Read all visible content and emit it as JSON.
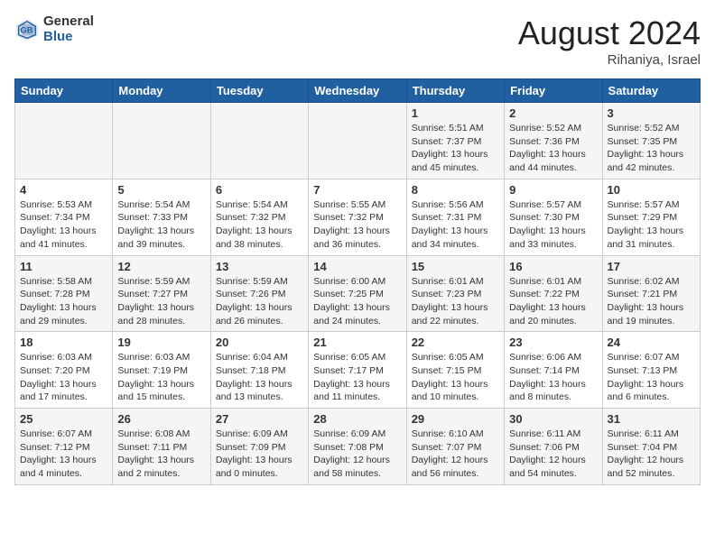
{
  "header": {
    "logo_general": "General",
    "logo_blue": "Blue",
    "month_year": "August 2024",
    "location": "Rihaniya, Israel"
  },
  "weekdays": [
    "Sunday",
    "Monday",
    "Tuesday",
    "Wednesday",
    "Thursday",
    "Friday",
    "Saturday"
  ],
  "weeks": [
    [
      {
        "day": "",
        "info": ""
      },
      {
        "day": "",
        "info": ""
      },
      {
        "day": "",
        "info": ""
      },
      {
        "day": "",
        "info": ""
      },
      {
        "day": "1",
        "info": "Sunrise: 5:51 AM\nSunset: 7:37 PM\nDaylight: 13 hours\nand 45 minutes."
      },
      {
        "day": "2",
        "info": "Sunrise: 5:52 AM\nSunset: 7:36 PM\nDaylight: 13 hours\nand 44 minutes."
      },
      {
        "day": "3",
        "info": "Sunrise: 5:52 AM\nSunset: 7:35 PM\nDaylight: 13 hours\nand 42 minutes."
      }
    ],
    [
      {
        "day": "4",
        "info": "Sunrise: 5:53 AM\nSunset: 7:34 PM\nDaylight: 13 hours\nand 41 minutes."
      },
      {
        "day": "5",
        "info": "Sunrise: 5:54 AM\nSunset: 7:33 PM\nDaylight: 13 hours\nand 39 minutes."
      },
      {
        "day": "6",
        "info": "Sunrise: 5:54 AM\nSunset: 7:32 PM\nDaylight: 13 hours\nand 38 minutes."
      },
      {
        "day": "7",
        "info": "Sunrise: 5:55 AM\nSunset: 7:32 PM\nDaylight: 13 hours\nand 36 minutes."
      },
      {
        "day": "8",
        "info": "Sunrise: 5:56 AM\nSunset: 7:31 PM\nDaylight: 13 hours\nand 34 minutes."
      },
      {
        "day": "9",
        "info": "Sunrise: 5:57 AM\nSunset: 7:30 PM\nDaylight: 13 hours\nand 33 minutes."
      },
      {
        "day": "10",
        "info": "Sunrise: 5:57 AM\nSunset: 7:29 PM\nDaylight: 13 hours\nand 31 minutes."
      }
    ],
    [
      {
        "day": "11",
        "info": "Sunrise: 5:58 AM\nSunset: 7:28 PM\nDaylight: 13 hours\nand 29 minutes."
      },
      {
        "day": "12",
        "info": "Sunrise: 5:59 AM\nSunset: 7:27 PM\nDaylight: 13 hours\nand 28 minutes."
      },
      {
        "day": "13",
        "info": "Sunrise: 5:59 AM\nSunset: 7:26 PM\nDaylight: 13 hours\nand 26 minutes."
      },
      {
        "day": "14",
        "info": "Sunrise: 6:00 AM\nSunset: 7:25 PM\nDaylight: 13 hours\nand 24 minutes."
      },
      {
        "day": "15",
        "info": "Sunrise: 6:01 AM\nSunset: 7:23 PM\nDaylight: 13 hours\nand 22 minutes."
      },
      {
        "day": "16",
        "info": "Sunrise: 6:01 AM\nSunset: 7:22 PM\nDaylight: 13 hours\nand 20 minutes."
      },
      {
        "day": "17",
        "info": "Sunrise: 6:02 AM\nSunset: 7:21 PM\nDaylight: 13 hours\nand 19 minutes."
      }
    ],
    [
      {
        "day": "18",
        "info": "Sunrise: 6:03 AM\nSunset: 7:20 PM\nDaylight: 13 hours\nand 17 minutes."
      },
      {
        "day": "19",
        "info": "Sunrise: 6:03 AM\nSunset: 7:19 PM\nDaylight: 13 hours\nand 15 minutes."
      },
      {
        "day": "20",
        "info": "Sunrise: 6:04 AM\nSunset: 7:18 PM\nDaylight: 13 hours\nand 13 minutes."
      },
      {
        "day": "21",
        "info": "Sunrise: 6:05 AM\nSunset: 7:17 PM\nDaylight: 13 hours\nand 11 minutes."
      },
      {
        "day": "22",
        "info": "Sunrise: 6:05 AM\nSunset: 7:15 PM\nDaylight: 13 hours\nand 10 minutes."
      },
      {
        "day": "23",
        "info": "Sunrise: 6:06 AM\nSunset: 7:14 PM\nDaylight: 13 hours\nand 8 minutes."
      },
      {
        "day": "24",
        "info": "Sunrise: 6:07 AM\nSunset: 7:13 PM\nDaylight: 13 hours\nand 6 minutes."
      }
    ],
    [
      {
        "day": "25",
        "info": "Sunrise: 6:07 AM\nSunset: 7:12 PM\nDaylight: 13 hours\nand 4 minutes."
      },
      {
        "day": "26",
        "info": "Sunrise: 6:08 AM\nSunset: 7:11 PM\nDaylight: 13 hours\nand 2 minutes."
      },
      {
        "day": "27",
        "info": "Sunrise: 6:09 AM\nSunset: 7:09 PM\nDaylight: 13 hours\nand 0 minutes."
      },
      {
        "day": "28",
        "info": "Sunrise: 6:09 AM\nSunset: 7:08 PM\nDaylight: 12 hours\nand 58 minutes."
      },
      {
        "day": "29",
        "info": "Sunrise: 6:10 AM\nSunset: 7:07 PM\nDaylight: 12 hours\nand 56 minutes."
      },
      {
        "day": "30",
        "info": "Sunrise: 6:11 AM\nSunset: 7:06 PM\nDaylight: 12 hours\nand 54 minutes."
      },
      {
        "day": "31",
        "info": "Sunrise: 6:11 AM\nSunset: 7:04 PM\nDaylight: 12 hours\nand 52 minutes."
      }
    ]
  ]
}
